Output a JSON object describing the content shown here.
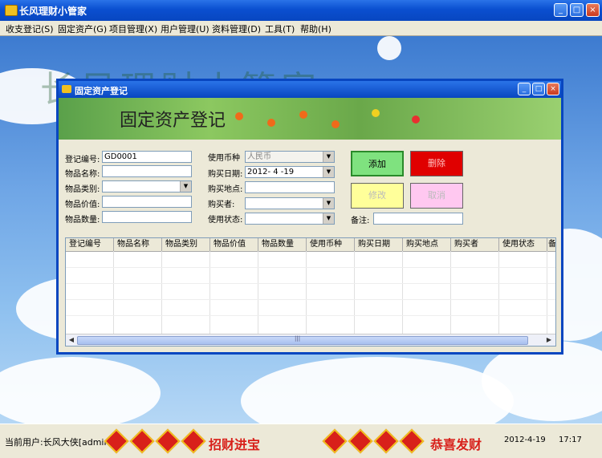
{
  "app": {
    "title": "长风理财小管家"
  },
  "menu": [
    "收支登记(S)",
    "固定资产(G)",
    "项目管理(X)",
    "用户管理(U)",
    "资料管理(D)",
    "工具(T)",
    "帮助(H)"
  ],
  "background": {
    "title": "长风理财小管家"
  },
  "dialog": {
    "title": "固定资产登记",
    "header_title": "固定资产登记",
    "fields": {
      "reg_no_label": "登记编号:",
      "reg_no_value": "GD0001",
      "name_label": "物品名称:",
      "category_label": "物品类别:",
      "price_label": "物品价值:",
      "qty_label": "物品数量:",
      "currency_label": "使用币种",
      "currency_value": "人民币",
      "buy_date_label": "购买日期:",
      "buy_date_value": "2012- 4 -19",
      "buy_place_label": "购买地点:",
      "buyer_label": "购买者:",
      "status_label": "使用状态:",
      "note_label": "备注:"
    },
    "buttons": {
      "add": "添加",
      "delete": "删除",
      "edit": "修改",
      "cancel": "取消"
    },
    "colors": {
      "add": "#7fe27f",
      "delete": "#e00000",
      "edit": "#ffff9a",
      "cancel": "#ffc8f0"
    },
    "grid_columns": [
      "登记编号",
      "物品名称",
      "物品类别",
      "物品价值",
      "物品数量",
      "使用币种",
      "购买日期",
      "购买地点",
      "购买者",
      "使用状态",
      "备"
    ],
    "scroll_grip": "|||"
  },
  "status": {
    "user": "当前用户:长风大侠[admin",
    "banner_left": "招财进宝",
    "banner_right": "恭喜发财",
    "date": "2012-4-19",
    "time": "17:17"
  }
}
